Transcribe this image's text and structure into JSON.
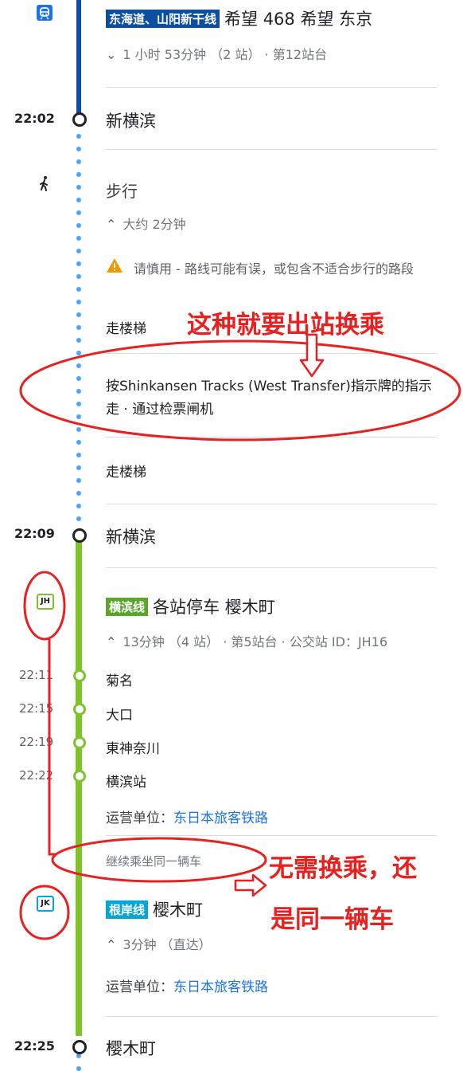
{
  "segment1": {
    "line_badge": "东海道、山阳新干线",
    "line_color": "#0c4ea2",
    "title": "希望 468 希望 东京",
    "details": "1 小时 53分钟 （2 站） · 第12站台"
  },
  "stop1": {
    "time": "22:02",
    "name": "新横滨"
  },
  "walk": {
    "title": "步行",
    "duration": "大约 2分钟",
    "warning": "请慎用 - 路线可能有误，或包含不适合步行的路段",
    "steps": [
      "走楼梯",
      "按Shinkansen Tracks (West Transfer)指示牌的指示走 · 通过检票闸机",
      "走楼梯"
    ]
  },
  "stop2": {
    "time": "22:09",
    "name": "新横滨"
  },
  "segment2": {
    "line_code": "JH",
    "line_badge": "横滨线",
    "line_color": "#7cc427",
    "title": "各站停车 樱木町",
    "details": "13分钟 （4 站） · 第5站台 · 公交站 ID：JH16",
    "intermediate": [
      {
        "time": "22:11",
        "name": "菊名"
      },
      {
        "time": "22:15",
        "name": "大口"
      },
      {
        "time": "22:19",
        "name": "東神奈川"
      },
      {
        "time": "22:22",
        "name": "横滨站"
      }
    ],
    "operator_label": "运营单位：",
    "operator": "东日本旅客铁路",
    "stay_on": "继续乘坐同一辆车"
  },
  "segment3": {
    "line_code": "JK",
    "line_badge": "根岸线",
    "line_color": "#00a7db",
    "title": "樱木町",
    "details": "3分钟 （直达）",
    "operator_label": "运营单位：",
    "operator": "东日本旅客铁路"
  },
  "stop3": {
    "time": "22:25",
    "name": "樱木町"
  },
  "annotations": {
    "note1": "这种就要出站换乘",
    "note2_line1": "无需换乘，还",
    "note2_line2": "是同一辆车"
  }
}
